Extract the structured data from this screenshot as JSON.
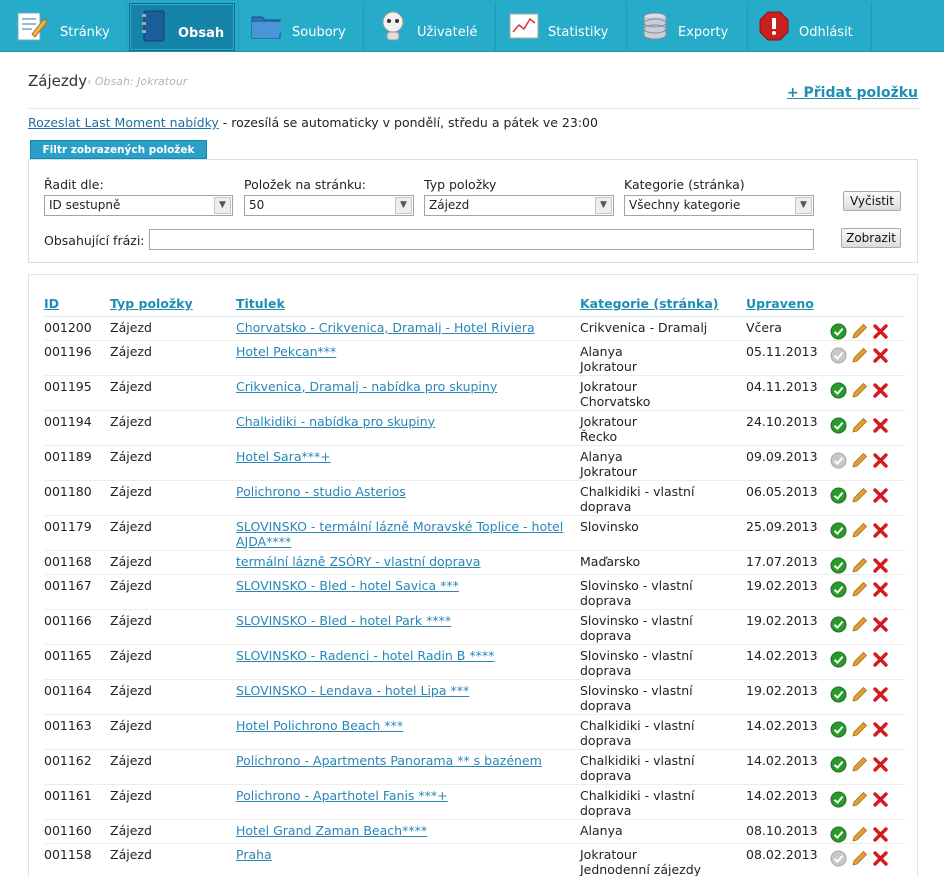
{
  "nav": {
    "items": [
      {
        "label": "Stránky",
        "icon": "pages-icon"
      },
      {
        "label": "Obsah",
        "icon": "notebook-icon",
        "active": true
      },
      {
        "label": "Soubory",
        "icon": "folder-icon"
      },
      {
        "label": "Uživatelé",
        "icon": "users-icon"
      },
      {
        "label": "Statistiky",
        "icon": "chart-icon"
      },
      {
        "label": "Exporty",
        "icon": "database-icon"
      },
      {
        "label": "Odhlásit",
        "icon": "stop-icon"
      }
    ]
  },
  "header": {
    "title": "Zájezdy",
    "breadcrumb": "‹ Obsah: Jokratour",
    "add_item": "+ Přidat položku"
  },
  "last_moment": {
    "link": "Rozeslat Last Moment nabídky",
    "text": " - rozesílá se automaticky v pondělí, středu a pátek ve 23:00"
  },
  "filter": {
    "tab": "Filtr zobrazených položek",
    "sort_label": "Řadit dle:",
    "sort_value": "ID sestupně",
    "per_page_label": "Položek na stránku:",
    "per_page_value": "50",
    "type_label": "Typ položky",
    "type_value": "Zájezd",
    "category_label": "Kategorie (stránka)",
    "category_value": "Všechny kategorie",
    "clear_button": "Vyčistit",
    "phrase_label": "Obsahující frázi:",
    "phrase_value": "",
    "show_button": "Zobrazit"
  },
  "table": {
    "headers": {
      "id": "ID",
      "type": "Typ položky",
      "title": "Titulek",
      "category": "Kategorie (stránka)",
      "updated": "Upraveno"
    },
    "rows": [
      {
        "id": "001200",
        "type": "Zájezd",
        "title": "Chorvatsko - Crikvenica, Dramalj - Hotel Riviera",
        "cat1": "Crikvenica - Dramalj",
        "cat2": "",
        "updated": "Včera",
        "active": true
      },
      {
        "id": "001196",
        "type": "Zájezd",
        "title": "Hotel Pekcan***",
        "cat1": "Alanya",
        "cat2": "Jokratour",
        "updated": "05.11.2013",
        "active": false
      },
      {
        "id": "001195",
        "type": "Zájezd",
        "title": "Crikvenica, Dramalj - nabídka pro skupiny",
        "cat1": "Jokratour",
        "cat2": "Chorvatsko",
        "updated": "04.11.2013",
        "active": true
      },
      {
        "id": "001194",
        "type": "Zájezd",
        "title": "Chalkidiki - nabídka pro skupiny",
        "cat1": "Jokratour",
        "cat2": "Řecko",
        "updated": "24.10.2013",
        "active": true
      },
      {
        "id": "001189",
        "type": "Zájezd",
        "title": "Hotel Sara***+",
        "cat1": "Alanya",
        "cat2": "Jokratour",
        "updated": "09.09.2013",
        "active": false
      },
      {
        "id": "001180",
        "type": "Zájezd",
        "title": "Polichrono - studio Asterios",
        "cat1": "Chalkidiki - vlastní",
        "cat2": "doprava",
        "updated": "06.05.2013",
        "active": true
      },
      {
        "id": "001179",
        "type": "Zájezd",
        "title": "SLOVINSKO - termální lázně Moravské Toplice - hotel AJDA****",
        "cat1": "Slovinsko",
        "cat2": "",
        "updated": "25.09.2013",
        "active": true
      },
      {
        "id": "001168",
        "type": "Zájezd",
        "title": "termální lázně ZSÓRY - vlastní doprava",
        "cat1": "Maďarsko",
        "cat2": "",
        "updated": "17.07.2013",
        "active": true
      },
      {
        "id": "001167",
        "type": "Zájezd",
        "title": "SLOVINSKO - Bled - hotel Savica ***",
        "cat1": "Slovinsko - vlastní",
        "cat2": "doprava",
        "updated": "19.02.2013",
        "active": true
      },
      {
        "id": "001166",
        "type": "Zájezd",
        "title": "SLOVINSKO - Bled - hotel Park ****",
        "cat1": "Slovinsko - vlastní",
        "cat2": "doprava",
        "updated": "19.02.2013",
        "active": true
      },
      {
        "id": "001165",
        "type": "Zájezd",
        "title": "SLOVINSKO - Radenci - hotel Radin B ****",
        "cat1": "Slovinsko - vlastní",
        "cat2": "doprava",
        "updated": "14.02.2013",
        "active": true
      },
      {
        "id": "001164",
        "type": "Zájezd",
        "title": "SLOVINSKO - Lendava - hotel Lipa ***",
        "cat1": "Slovinsko - vlastní",
        "cat2": "doprava",
        "updated": "19.02.2013",
        "active": true
      },
      {
        "id": "001163",
        "type": "Zájezd",
        "title": "Hotel Polichrono Beach ***",
        "cat1": "Chalkidiki - vlastní",
        "cat2": "doprava",
        "updated": "14.02.2013",
        "active": true
      },
      {
        "id": "001162",
        "type": "Zájezd",
        "title": "Polichrono - Apartments Panorama ** s bazénem",
        "cat1": "Chalkidiki - vlastní",
        "cat2": "doprava",
        "updated": "14.02.2013",
        "active": true
      },
      {
        "id": "001161",
        "type": "Zájezd",
        "title": "Polichrono - Aparthotel Fanis ***+",
        "cat1": "Chalkidiki - vlastní",
        "cat2": "doprava",
        "updated": "14.02.2013",
        "active": true
      },
      {
        "id": "001160",
        "type": "Zájezd",
        "title": "Hotel Grand Zaman Beach****",
        "cat1": "Alanya",
        "cat2": "",
        "updated": "08.10.2013",
        "active": true
      },
      {
        "id": "001158",
        "type": "Zájezd",
        "title": "Praha",
        "cat1": "Jokratour",
        "cat2": "Jednodenní zájezdy",
        "updated": "08.02.2013",
        "active": false
      }
    ]
  },
  "colors": {
    "nav_bg": "#26abc9",
    "nav_active": "#1583a8",
    "link": "#2a86b6",
    "check_on": "#2a9a2a",
    "check_off": "#c8c8c8",
    "delete": "#d41a1a",
    "edit": "#e0a030"
  }
}
